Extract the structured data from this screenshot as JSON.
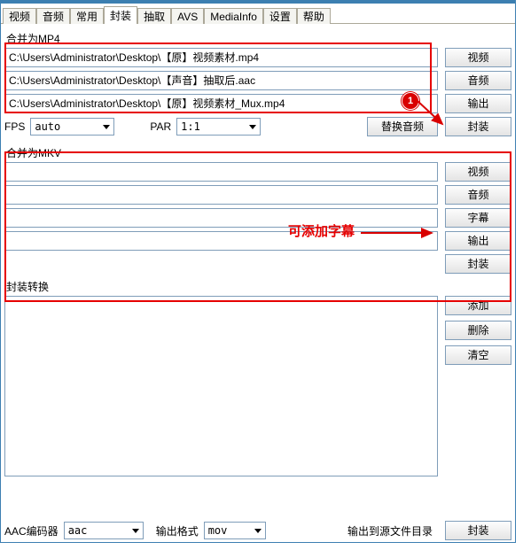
{
  "tabs": [
    "视频",
    "音频",
    "常用",
    "封装",
    "抽取",
    "AVS",
    "MediaInfo",
    "设置",
    "帮助"
  ],
  "active_tab_index": 3,
  "mp4": {
    "title": "合并为MP4",
    "video_path": "C:\\Users\\Administrator\\Desktop\\【原】视频素材.mp4",
    "audio_path": "C:\\Users\\Administrator\\Desktop\\【声音】抽取后.aac",
    "output_path": "C:\\Users\\Administrator\\Desktop\\【原】视频素材_Mux.mp4",
    "btn_video": "视频",
    "btn_audio": "音频",
    "btn_output": "输出",
    "fps_label": "FPS",
    "fps_value": "auto",
    "par_label": "PAR",
    "par_value": "1:1",
    "btn_replace_audio": "替换音频",
    "btn_mux": "封装"
  },
  "mkv": {
    "title": "合并为MKV",
    "btn_video": "视频",
    "btn_audio": "音频",
    "btn_subtitle": "字幕",
    "btn_output": "输出",
    "btn_mux": "封装"
  },
  "container": {
    "title": "封装转换",
    "btn_add": "添加",
    "btn_delete": "删除",
    "btn_clear": "清空"
  },
  "bottom": {
    "aac_label": "AAC编码器",
    "aac_value": "aac",
    "fmt_label": "输出格式",
    "fmt_value": "mov",
    "outdir_label": "输出到源文件目录",
    "btn_mux": "封装"
  },
  "annotations": {
    "badge1": "1",
    "subtitle_note": "可添加字幕"
  }
}
